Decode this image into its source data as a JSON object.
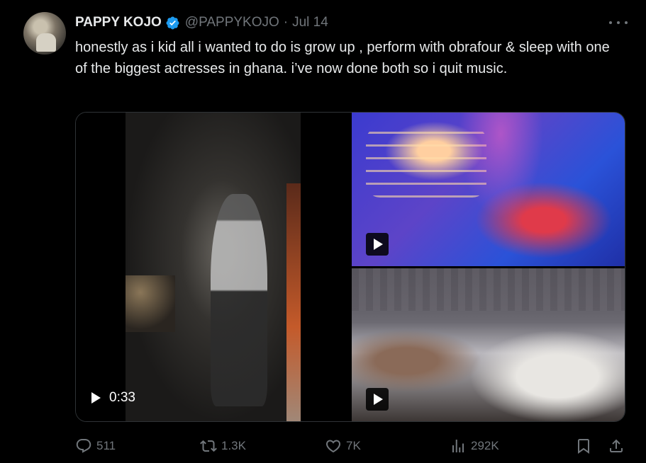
{
  "tweet": {
    "author_name": "PAPPY KOJO",
    "handle": "@PAPPYKOJO",
    "separator": "·",
    "date": "Jul 14",
    "verified": true,
    "text": "honestly as i kid all i wanted to do is grow up , perform with obrafour & sleep with one of the biggest actresses in ghana. i’ve now done both so i quit music."
  },
  "media": {
    "main_video_duration": "0:33"
  },
  "actions": {
    "reply_count": "511",
    "retweet_count": "1.3K",
    "like_count": "7K",
    "view_count": "292K"
  },
  "colors": {
    "background": "#000000",
    "text_primary": "#e7e9ea",
    "text_secondary": "#71767b",
    "verified_blue": "#1d9bf0",
    "border": "#2f3336"
  },
  "icons": [
    "verified-badge-icon",
    "more-options-icon",
    "play-icon",
    "reply-icon",
    "retweet-icon",
    "like-icon",
    "views-icon",
    "bookmark-icon",
    "share-icon"
  ]
}
